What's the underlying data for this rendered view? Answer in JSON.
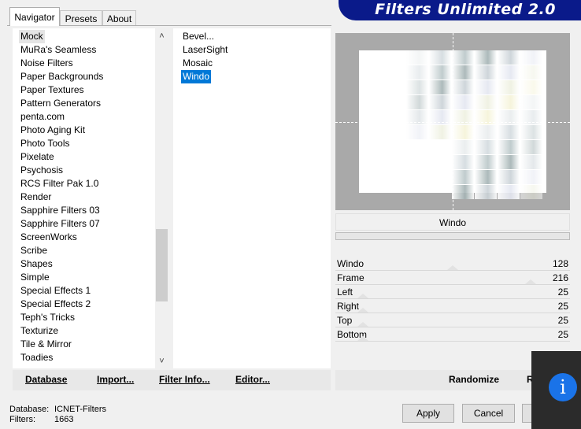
{
  "tabs": [
    {
      "label": "Navigator",
      "active": true
    },
    {
      "label": "Presets",
      "active": false
    },
    {
      "label": "About",
      "active": false
    }
  ],
  "banner": {
    "title": "Filters Unlimited 2.0",
    "color": "#0a1a8a"
  },
  "categories": [
    "Mock",
    "MuRa's Seamless",
    "Noise Filters",
    "Paper Backgrounds",
    "Paper Textures",
    "Pattern Generators",
    "penta.com",
    "Photo Aging Kit",
    "Photo Tools",
    "Pixelate",
    "Psychosis",
    "RCS Filter Pak 1.0",
    "Render",
    "Sapphire Filters 03",
    "Sapphire Filters 07",
    "ScreenWorks",
    "Scribe",
    "Shapes",
    "Simple",
    "Special Effects 1",
    "Special Effects 2",
    "Teph's Tricks",
    "Texturize",
    "Tile & Mirror",
    "Toadies"
  ],
  "selected_category": "Mock",
  "filters": [
    "Bevel...",
    "LaserSight",
    "Mosaic",
    "Windo"
  ],
  "selected_filter": "Windo",
  "preview": {
    "filter_name": "Windo"
  },
  "parameters": [
    {
      "label": "Windo",
      "value": "128",
      "level": 0.5
    },
    {
      "label": "Frame",
      "value": "216",
      "level": 0.85
    },
    {
      "label": "Left",
      "value": "25",
      "level": 0.1
    },
    {
      "label": "Right",
      "value": "25",
      "level": 0.1
    },
    {
      "label": "Top",
      "value": "25",
      "level": 0.1
    },
    {
      "label": "Bottom",
      "value": "25",
      "level": 0.1
    }
  ],
  "toolbar": {
    "database": "Database",
    "import": "Import...",
    "filter_info": "Filter Info...",
    "editor": "Editor...",
    "randomize": "Randomize",
    "reset": "R"
  },
  "status": {
    "database_label": "Database:",
    "database_value": "ICNET-Filters",
    "filters_label": "Filters:",
    "filters_value": "1663"
  },
  "buttons": {
    "apply": "Apply",
    "cancel": "Cancel"
  },
  "overlay": {
    "icon": "info-icon",
    "glyph": "i"
  }
}
